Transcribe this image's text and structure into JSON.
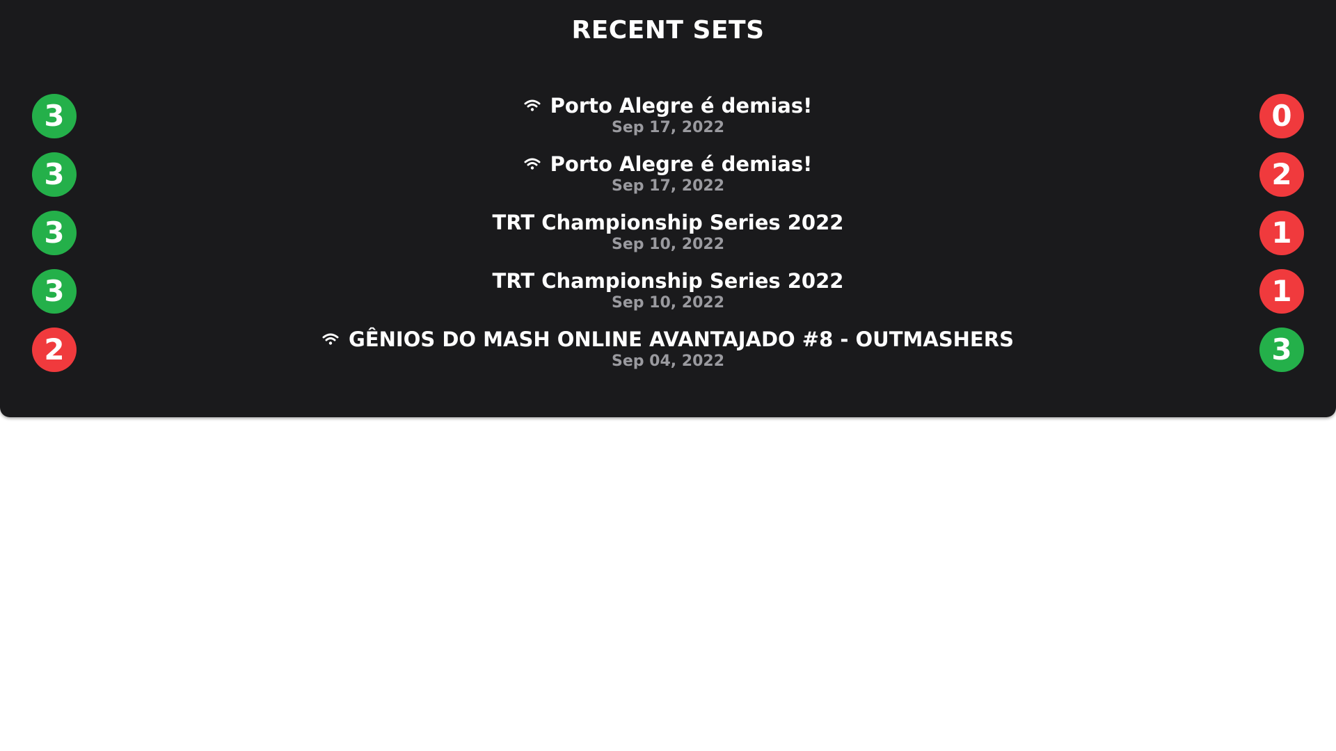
{
  "title": "RECENT SETS",
  "colors": {
    "win": "#24b04a",
    "loss": "#f03a3d",
    "background": "#1a1a1c",
    "date": "#9a9a9f"
  },
  "sets": [
    {
      "tournament": "Porto Alegre é demias!",
      "date": "Sep 17, 2022",
      "online": true,
      "score_left": "3",
      "score_right": "0",
      "left_result": "win",
      "right_result": "loss"
    },
    {
      "tournament": "Porto Alegre é demias!",
      "date": "Sep 17, 2022",
      "online": true,
      "score_left": "3",
      "score_right": "2",
      "left_result": "win",
      "right_result": "loss"
    },
    {
      "tournament": "TRT Championship Series 2022",
      "date": "Sep 10, 2022",
      "online": false,
      "score_left": "3",
      "score_right": "1",
      "left_result": "win",
      "right_result": "loss"
    },
    {
      "tournament": "TRT Championship Series 2022",
      "date": "Sep 10, 2022",
      "online": false,
      "score_left": "3",
      "score_right": "1",
      "left_result": "win",
      "right_result": "loss"
    },
    {
      "tournament": "GÊNIOS DO MASH ONLINE AVANTAJADO #8 - OUTMASHERS",
      "date": "Sep 04, 2022",
      "online": true,
      "score_left": "2",
      "score_right": "3",
      "left_result": "loss",
      "right_result": "win"
    }
  ]
}
